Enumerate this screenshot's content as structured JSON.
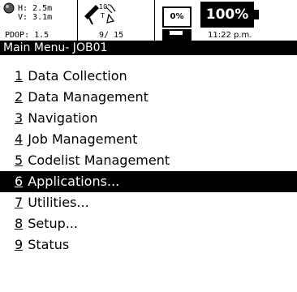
{
  "status": {
    "h_precision": "H: 2.5m",
    "v_precision": "V: 3.1m",
    "pdop": "PDOP: 1.5",
    "elevation_mask": "10°",
    "tracking_mode": "T",
    "sv_count": "9/ 15",
    "memory_percent": "0%",
    "battery_percent": "100%",
    "time": "11:22 p.m."
  },
  "title": "Main Menu- JOB01",
  "menu": {
    "selected_index": 5,
    "items": [
      {
        "num": "1",
        "label": "Data Collection"
      },
      {
        "num": "2",
        "label": "Data Management"
      },
      {
        "num": "3",
        "label": "Navigation"
      },
      {
        "num": "4",
        "label": "Job Management"
      },
      {
        "num": "5",
        "label": "Codelist Management"
      },
      {
        "num": "6",
        "label": "Applications..."
      },
      {
        "num": "7",
        "label": "Utilities..."
      },
      {
        "num": "8",
        "label": "Setup..."
      },
      {
        "num": "9",
        "label": "Status"
      }
    ]
  },
  "icons": [
    "gps-status-icon",
    "satellite-dish-icon",
    "radio-link-icon",
    "memory-disk-icon",
    "battery-icon"
  ]
}
